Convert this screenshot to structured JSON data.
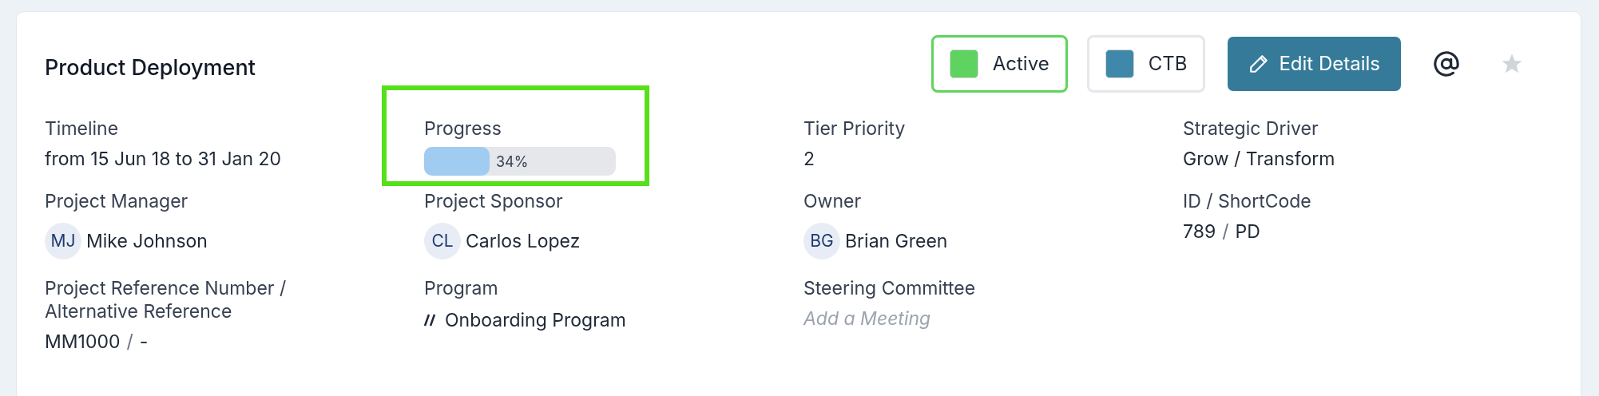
{
  "title": "Product Deployment",
  "status_chips": [
    {
      "label": "Active",
      "color": "#5fd35f",
      "selected": true
    },
    {
      "label": "CTB",
      "color": "#3f88aa",
      "selected": false
    }
  ],
  "edit_button": {
    "label": "Edit Details"
  },
  "starred": false,
  "fields": [
    {
      "kind": "text",
      "label": "Timeline",
      "value": "from 15 Jun 18 to 31 Jan 20"
    },
    {
      "kind": "progress",
      "label": "Progress",
      "level": 0.34,
      "reading": "34%",
      "highlighted": true
    },
    {
      "kind": "text",
      "label": "Tier Priority",
      "value": "2"
    },
    {
      "kind": "text",
      "label": "Strategic Driver",
      "value": "Grow / Transform"
    },
    {
      "kind": "person",
      "label": "Project Manager",
      "initials": "MJ",
      "value": "Mike Johnson"
    },
    {
      "kind": "person",
      "label": "Project Sponsor",
      "initials": "CL",
      "value": "Carlos Lopez"
    },
    {
      "kind": "person",
      "label": "Owner",
      "initials": "BG",
      "value": "Brian Green"
    },
    {
      "kind": "pair",
      "label": "ID / ShortCode",
      "first": "789",
      "separator": "/",
      "second": "PD"
    },
    {
      "kind": "pair",
      "label": "Project Reference Number / Alternative Reference",
      "first": "MM1000",
      "separator": "/",
      "second": "-"
    },
    {
      "kind": "program",
      "label": "Program",
      "value": "Onboarding Program"
    },
    {
      "kind": "placeholder",
      "label": "Steering Committee",
      "placeholder": "Add a Meeting"
    }
  ]
}
